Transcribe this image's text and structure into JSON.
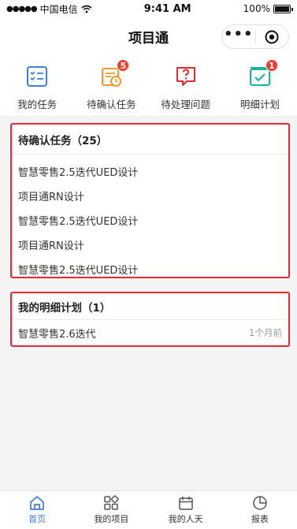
{
  "statusbar": {
    "carrier": "中国电信",
    "time": "9:41 AM",
    "battery": "100%"
  },
  "navbar": {
    "title": "项目通"
  },
  "quick": [
    {
      "label": "我的任务",
      "icon": "task-list-icon",
      "badge": ""
    },
    {
      "label": "待确认任务",
      "icon": "pending-calendar-icon",
      "badge": "5"
    },
    {
      "label": "待处理问题",
      "icon": "question-bubble-icon",
      "badge": ""
    },
    {
      "label": "明细计划",
      "icon": "check-plan-icon",
      "badge": "1"
    }
  ],
  "pending_card": {
    "title": "待确认任务（25）",
    "items": [
      "智慧零售2.5迭代UED设计",
      "项目通RN设计",
      "智慧零售2.5迭代UED设计",
      "项目通RN设计",
      "智慧零售2.5迭代UED设计"
    ]
  },
  "plan_card": {
    "title": "我的明细计划（1）",
    "items": [
      {
        "name": "智慧零售2.6迭代",
        "time": "1个月前"
      }
    ]
  },
  "tabbar": {
    "tabs": [
      {
        "label": "首页",
        "icon": "home-icon",
        "active": true
      },
      {
        "label": "我的项目",
        "icon": "apps-grid-icon",
        "active": false
      },
      {
        "label": "我的人天",
        "icon": "calendar-icon",
        "active": false
      },
      {
        "label": "报表",
        "icon": "pie-chart-icon",
        "active": false
      }
    ]
  },
  "colors": {
    "accent_blue": "#3f7ed8",
    "orange": "#f19a2b",
    "red": "#e8292f",
    "teal": "#1cb39a",
    "badge_red": "#f23b2f"
  }
}
